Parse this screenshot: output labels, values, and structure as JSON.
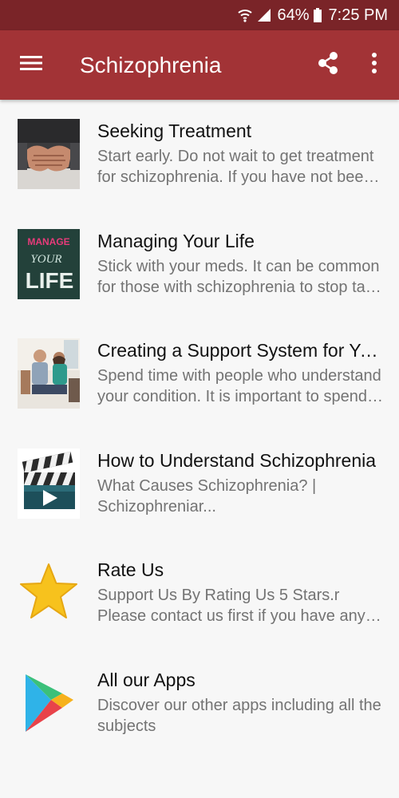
{
  "status_bar": {
    "battery": "64%",
    "time": "7:25 PM"
  },
  "app_bar": {
    "title": "Schizophrenia",
    "menu_icon": "hamburger-menu-icon",
    "share_icon": "share-icon",
    "more_icon": "more-vert-icon"
  },
  "colors": {
    "status_bar": "#7a2428",
    "app_bar": "#a23336",
    "background": "#f7f7f7",
    "title_text": "#111111",
    "desc_text": "#737373"
  },
  "items": [
    {
      "title": "Seeking Treatment",
      "desc_line1": "Start early. Do not wait to get treatment",
      "desc_line2": "for schizophrenia. If you have not been …",
      "thumb": "praying-hands-image"
    },
    {
      "title": "Managing Your Life",
      "desc_line1": "Stick with your meds. It can be common",
      "desc_line2": "for those with schizophrenia to stop tak…",
      "thumb": "manage-your-life-chalkboard-image",
      "thumb_text_1": "MANAGE",
      "thumb_text_2": "YOUR",
      "thumb_text_3": "LIFE"
    },
    {
      "title": "Creating a Support System for Yo…",
      "desc_line1": "Spend time with people who understand",
      "desc_line2": "your condition. It is important to spend …",
      "thumb": "support-group-people-image"
    },
    {
      "title": "How to Understand Schizophrenia",
      "desc_line1": "What Causes Schizophrenia? |",
      "desc_line2": "Schizophreniar...",
      "thumb": "video-clapperboard-icon"
    },
    {
      "title": "Rate Us",
      "desc_line1": "Support Us By Rating Us 5 Stars.r",
      "desc_line2": "Please contact us first if you have any q…",
      "thumb": "star-icon"
    },
    {
      "title": "All our Apps",
      "desc_line1": "Discover our other apps including all the",
      "desc_line2": "subjects",
      "thumb": "play-store-icon"
    }
  ]
}
